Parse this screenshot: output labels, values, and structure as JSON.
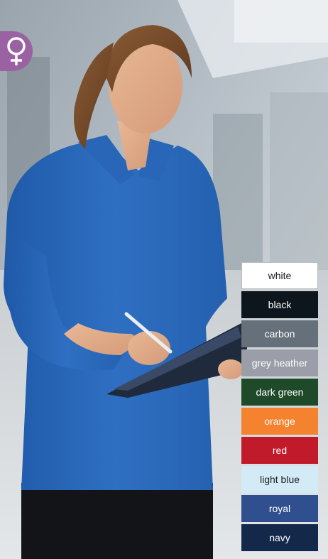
{
  "gender_badge": {
    "icon": "female-symbol-icon",
    "color": "#9a62a3"
  },
  "swatches": [
    {
      "label": "white",
      "bg": "#ffffff",
      "fg": "#222222",
      "border": "#bbbbbb"
    },
    {
      "label": "black",
      "bg": "#0d161c",
      "fg": "#ffffff"
    },
    {
      "label": "carbon",
      "bg": "#66707a",
      "fg": "#ffffff"
    },
    {
      "label": "grey heather",
      "bg": "#9b9ea9",
      "fg": "#ffffff"
    },
    {
      "label": "dark green",
      "bg": "#1e4a2a",
      "fg": "#ffffff"
    },
    {
      "label": "orange",
      "bg": "#f4822e",
      "fg": "#ffffff"
    },
    {
      "label": "red",
      "bg": "#c11b2b",
      "fg": "#ffffff"
    },
    {
      "label": "light blue",
      "bg": "#d3eaf7",
      "fg": "#222222"
    },
    {
      "label": "royal",
      "bg": "#2f4f8f",
      "fg": "#ffffff"
    },
    {
      "label": "navy",
      "bg": "#14294a",
      "fg": "#ffffff"
    }
  ]
}
